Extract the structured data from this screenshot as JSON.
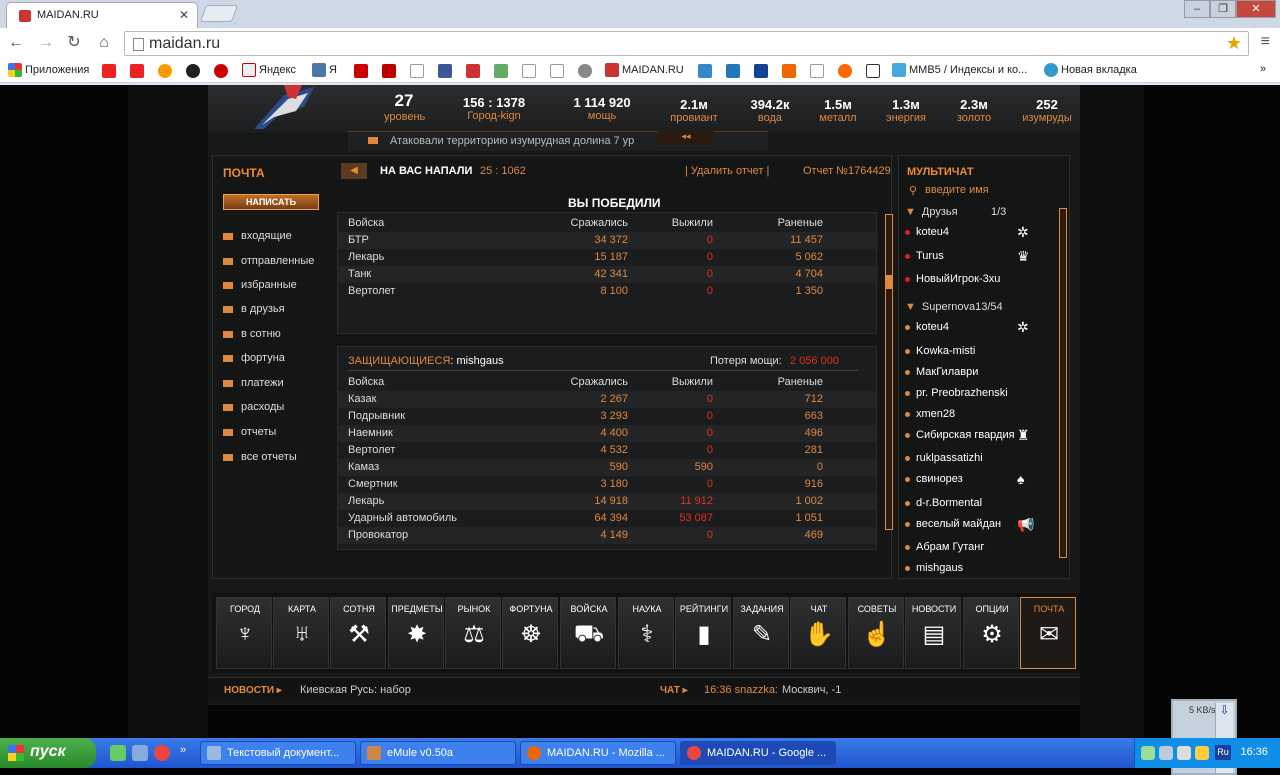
{
  "browser": {
    "tab_title": "MAIDAN.RU",
    "url": "maidan.ru",
    "bookmarks": [
      "Приложения",
      "Яндекс",
      "Я",
      "MAIDAN.RU",
      "MMB5 / Индексы и ко...",
      "Новая вкладка"
    ]
  },
  "game": {
    "stats": [
      {
        "value": "27",
        "label": "уровень"
      },
      {
        "value": "156 : 1378",
        "label": "Город-kign"
      },
      {
        "value": "1 114 920",
        "label": "мощь"
      }
    ],
    "resources": [
      {
        "value": "2.1м",
        "label": "провиант"
      },
      {
        "value": "394.2к",
        "label": "вода"
      },
      {
        "value": "1.5м",
        "label": "металл"
      },
      {
        "value": "1.3м",
        "label": "энергия"
      },
      {
        "value": "2.3м",
        "label": "золото"
      },
      {
        "value": "252",
        "label": "изумруды"
      }
    ],
    "ticker": "Атаковали территорию изумрудная долина 7 ур",
    "ticker_button": "◂◂"
  },
  "mail": {
    "title": "ПОЧТА",
    "write_button": "НАПИСАТЬ",
    "folders": [
      "входящие",
      "отправленные",
      "избранные",
      "в друзья",
      "в сотню",
      "фортуна",
      "платежи",
      "расходы",
      "отчеты",
      "все отчеты"
    ],
    "back_button": "◀",
    "report_title": "НА ВАС НАПАЛИ",
    "coords": "25 : 1062",
    "delete_link": "| Удалить отчет |",
    "report_number": "Отчет №1764429",
    "result": "ВЫ ПОБЕДИЛИ",
    "columns": [
      "Войска",
      "Сражались",
      "Выжили",
      "Раненые"
    ],
    "attacker_rows": [
      [
        "БТР",
        "34 372",
        "0",
        "11 457"
      ],
      [
        "Лекарь",
        "15 187",
        "0",
        "5 062"
      ],
      [
        "Танк",
        "42 341",
        "0",
        "4 704"
      ],
      [
        "Вертолет",
        "8 100",
        "0",
        "1 350"
      ]
    ],
    "defenders_label": "ЗАЩИЩАЮЩИЕСЯ",
    "defenders_name": ": mishgaus",
    "power_loss_label": "Потеря мощи:",
    "power_loss_value": "2 056 000",
    "defender_rows": [
      [
        "Казак",
        "2 267",
        "0",
        "712"
      ],
      [
        "Подрывник",
        "3 293",
        "0",
        "663"
      ],
      [
        "Наемник",
        "4 400",
        "0",
        "496"
      ],
      [
        "Вертолет",
        "4 532",
        "0",
        "281"
      ],
      [
        "Камаз",
        "590",
        "590",
        "0"
      ],
      [
        "Смертник",
        "3 180",
        "0",
        "916"
      ],
      [
        "Лекарь",
        "14 918",
        "11 912",
        "1 002"
      ],
      [
        "Ударный автомобиль",
        "64 394",
        "53 087",
        "1 051"
      ],
      [
        "Провокатор",
        "4 149",
        "0",
        "469"
      ]
    ]
  },
  "chat": {
    "title": "МУЛЬТИЧАТ",
    "search_placeholder": "введите имя",
    "friends_group": "Друзья",
    "friends_count": "1/3",
    "friends": [
      {
        "name": "koteu4",
        "badge": "✲",
        "online": "red"
      },
      {
        "name": "Turus",
        "badge": "♛",
        "online": "red"
      },
      {
        "name": "НовыйИгрок-3xu",
        "badge": "",
        "online": "red"
      }
    ],
    "clan_group": "Supernova13/54",
    "clan": [
      {
        "name": "koteu4",
        "badge": "✲"
      },
      {
        "name": "Kowka-misti",
        "badge": ""
      },
      {
        "name": "МакГилаври",
        "badge": ""
      },
      {
        "name": "pr. Preobrazhenski",
        "badge": ""
      },
      {
        "name": "xmen28",
        "badge": ""
      },
      {
        "name": "Сибирская гвардия",
        "badge": "♜"
      },
      {
        "name": "ruklpassatizhi",
        "badge": ""
      },
      {
        "name": "свинорез",
        "badge": "♠"
      },
      {
        "name": "d-r.Bormental",
        "badge": ""
      },
      {
        "name": "веселый майдан",
        "badge": "📢"
      },
      {
        "name": "Абрам Гутанг",
        "badge": ""
      },
      {
        "name": "mishgaus",
        "badge": ""
      }
    ]
  },
  "menu": [
    {
      "label": "ГОРОД",
      "icon": "♆"
    },
    {
      "label": "КАРТА",
      "icon": "♅"
    },
    {
      "label": "СОТНЯ",
      "icon": "⚒"
    },
    {
      "label": "ПРЕДМЕТЫ",
      "icon": "✸"
    },
    {
      "label": "РЫНОК",
      "icon": "⚖"
    },
    {
      "label": "ФОРТУНА",
      "icon": "☸"
    },
    {
      "label": "ВОЙСКА",
      "icon": "⛟"
    },
    {
      "label": "НАУКА",
      "icon": "⚕"
    },
    {
      "label": "РЕЙТИНГИ",
      "icon": "▮"
    },
    {
      "label": "ЗАДАНИЯ",
      "icon": "✎"
    },
    {
      "label": "ЧАТ",
      "icon": "✋"
    },
    {
      "label": "СОВЕТЫ",
      "icon": "☝"
    },
    {
      "label": "НОВОСТИ",
      "icon": "▤"
    },
    {
      "label": "ОПЦИИ",
      "icon": "⚙"
    },
    {
      "label": "ПОЧТА",
      "icon": "✉"
    }
  ],
  "bottom": {
    "news_label": "НОВОСТИ",
    "news_text": "Киевская Русь: набор",
    "chat_label": "ЧАТ",
    "chat_time": "16:36 snazzka:",
    "chat_text": "Москвич, -1"
  },
  "download": {
    "speed": "5 KB/s"
  },
  "taskbar": {
    "start": "пуск",
    "tasks": [
      "Текстовый документ...",
      "eMule v0.50a",
      "MAIDAN.RU - Mozilla ...",
      "MAIDAN.RU - Google ..."
    ],
    "lang": "Ru",
    "clock": "16:36"
  }
}
